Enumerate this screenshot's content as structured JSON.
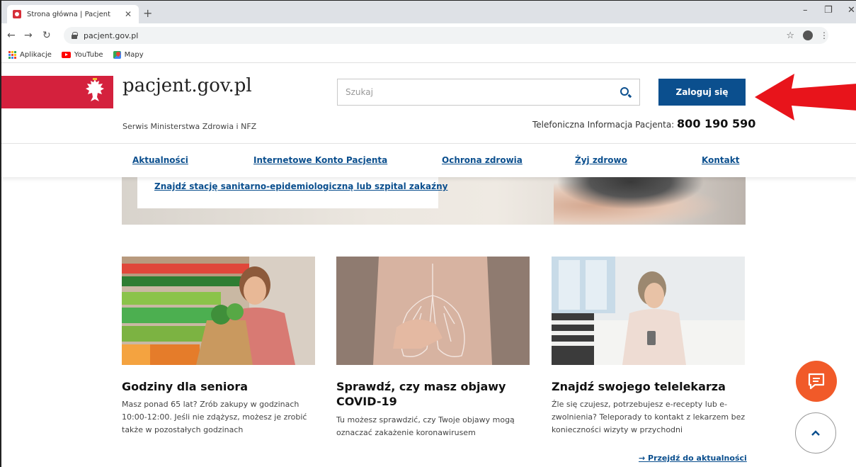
{
  "browser": {
    "tab_title": "Strona główna | Pacjent",
    "url": "pacjent.gov.pl",
    "bookmarks": [
      "Aplikacje",
      "YouTube",
      "Mapy"
    ],
    "icons": [
      "favicon-icon",
      "close-icon",
      "new-tab-icon",
      "back-icon",
      "forward-icon",
      "reload-icon",
      "lock-icon",
      "star-icon",
      "profile-icon",
      "menu-icon"
    ]
  },
  "header": {
    "site_name": "pacjent.gov.pl",
    "subtitle": "Serwis Ministerstwa Zdrowia i NFZ",
    "search_placeholder": "Szukaj",
    "login_label": "Zaloguj się",
    "phone_label": "Telefoniczna Informacja Pacjenta:",
    "phone_number": "800 190 590",
    "brand_color": "#d4213d",
    "accent_color": "#0b4f8e"
  },
  "nav": {
    "items": [
      "Aktualności",
      "Internetowe Konto Pacjenta",
      "Ochrona zdrowia",
      "Żyj zdrowo",
      "Kontakt"
    ]
  },
  "hero": {
    "link": "Znajdź stację sanitarno-epidemiologiczną lub szpital zakaźny"
  },
  "cards": [
    {
      "title": "Godziny dla seniora",
      "text": "Masz ponad 65 lat? Zrób zakupy w godzinach 10:00-12:00. Jeśli nie zdążysz, możesz je zrobić także w pozostałych godzinach"
    },
    {
      "title": "Sprawdź, czy masz objawy COVID-19",
      "text": "Tu możesz sprawdzić, czy Twoje objawy mogą oznaczać zakażenie koronawirusem"
    },
    {
      "title": "Znajdź swojego telelekarza",
      "text": "Źle się czujesz, potrzebujesz e-recepty lub e-zwolnienia? Teleporady to kontakt z lekarzem bez konieczności wizyty w przychodni"
    }
  ],
  "more_link": "→ Przejdź do aktualności",
  "floating": {
    "chat_color": "#f15a29"
  }
}
